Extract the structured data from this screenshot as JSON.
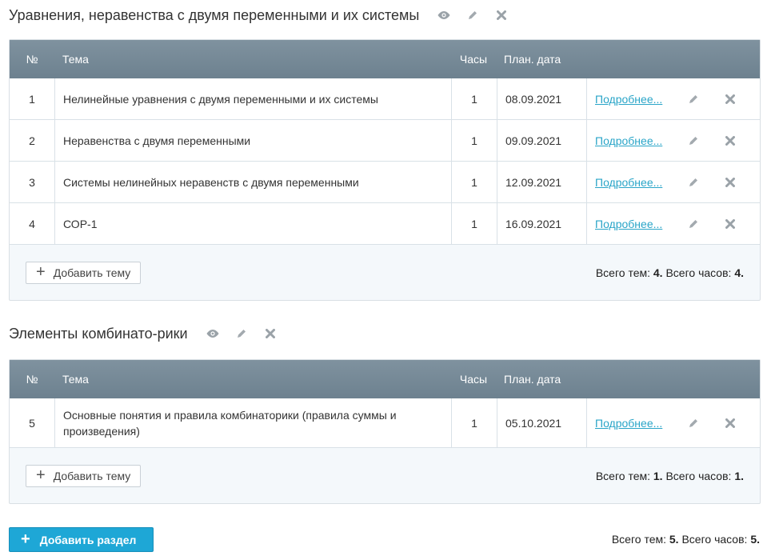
{
  "sections": [
    {
      "title": "Уравнения, неравенства с двумя переменными и их системы",
      "columns": {
        "num": "№",
        "topic": "Тема",
        "hours": "Часы",
        "date": "План. дата"
      },
      "rows": [
        {
          "num": "1",
          "topic": "Нелинейные уравнения с двумя переменными и их системы",
          "hours": "1",
          "date": "08.09.2021",
          "link": "Подробнее..."
        },
        {
          "num": "2",
          "topic": "Неравенства с двумя переменными",
          "hours": "1",
          "date": "09.09.2021",
          "link": "Подробнее..."
        },
        {
          "num": "3",
          "topic": "Системы нелинейных неравенств с двумя переменными",
          "hours": "1",
          "date": "12.09.2021",
          "link": "Подробнее..."
        },
        {
          "num": "4",
          "topic": "СОР-1",
          "hours": "1",
          "date": "16.09.2021",
          "link": "Подробнее..."
        }
      ],
      "add_topic_label": "Добавить тему",
      "totals": {
        "topics_label": "Всего тем:",
        "topics": "4.",
        "hours_label": "Всего часов:",
        "hours": "4."
      }
    },
    {
      "title": "Элементы комбинато-рики",
      "columns": {
        "num": "№",
        "topic": "Тема",
        "hours": "Часы",
        "date": "План. дата"
      },
      "rows": [
        {
          "num": "5",
          "topic": "Основные понятия и правила комбинаторики (правила суммы и произведения)",
          "hours": "1",
          "date": "05.10.2021",
          "link": "Подробнее..."
        }
      ],
      "add_topic_label": "Добавить тему",
      "totals": {
        "topics_label": "Всего тем:",
        "topics": "1.",
        "hours_label": "Всего часов:",
        "hours": "1."
      }
    }
  ],
  "add_section_label": "Добавить раздел",
  "grand_totals": {
    "topics_label": "Всего тем:",
    "topics": "5.",
    "hours_label": "Всего часов:",
    "hours": "5."
  },
  "icons": {
    "view": "eye-icon",
    "edit": "pencil-icon",
    "delete": "close-icon",
    "add": "plus-icon"
  },
  "colors": {
    "header_bg": "#768a98",
    "link": "#2aa5c8",
    "primary_button": "#1ea7d6",
    "panel_bg": "#f4f8fb"
  }
}
